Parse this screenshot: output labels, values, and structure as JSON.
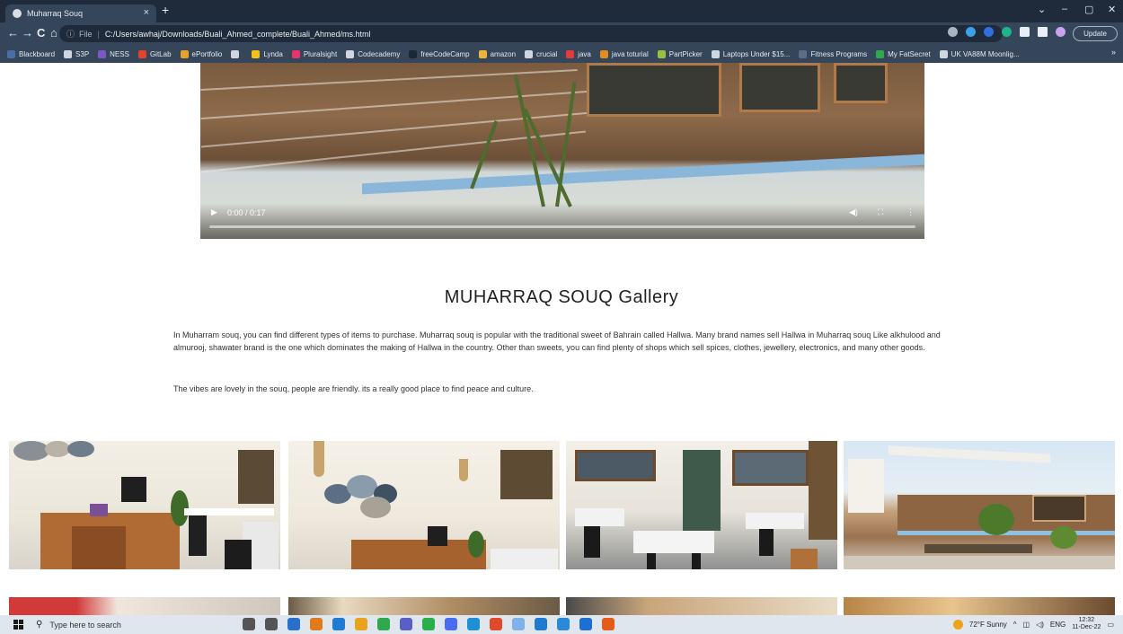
{
  "browser": {
    "tab_title": "Muharraq Souq",
    "tab_close": "×",
    "new_tab": "+",
    "window_controls": [
      "⌄",
      "–",
      "▢",
      "✕"
    ],
    "nav": {
      "back": "←",
      "forward": "→",
      "reload": "C",
      "home": "⌂"
    },
    "address": {
      "scheme_label": "File",
      "url": "C:/Users/awhaj/Downloads/Buali_Ahmed_complete/Buali_Ahmed/ms.html"
    },
    "update_label": "Update",
    "bookmarks": [
      {
        "label": "Blackboard",
        "color": "#4a6fa5"
      },
      {
        "label": "S3P",
        "color": "#cfd6df"
      },
      {
        "label": "NESS",
        "color": "#7e57c2"
      },
      {
        "label": "GitLab",
        "color": "#e2432a"
      },
      {
        "label": "ePortfolio",
        "color": "#e7a22b"
      },
      {
        "label": "",
        "color": "#cfd6df"
      },
      {
        "label": "Lynda",
        "color": "#f2c21b"
      },
      {
        "label": "Pluralsight",
        "color": "#e9346a"
      },
      {
        "label": "Codecademy",
        "color": "#cfd6df"
      },
      {
        "label": "freeCodeCamp",
        "color": "#1b2838"
      },
      {
        "label": "amazon",
        "color": "#f0b23b"
      },
      {
        "label": "crucial",
        "color": "#cfd6df"
      },
      {
        "label": "java",
        "color": "#e23b3b"
      },
      {
        "label": "java toturial",
        "color": "#e58b1f"
      },
      {
        "label": "PartPicker",
        "color": "#9bbf3a"
      },
      {
        "label": "Laptops Under $15...",
        "color": "#cfd6df"
      },
      {
        "label": "Fitness Programs",
        "color": "#5a6f86"
      },
      {
        "label": "My FatSecret",
        "color": "#2fa84f"
      },
      {
        "label": "UK VA88M Moonlig...",
        "color": "#cfd6df"
      }
    ],
    "bookmarks_more": "»"
  },
  "video": {
    "time": "0:00 / 0:17",
    "play_icon": "▶",
    "volume_icon": "◀)",
    "fullscreen_icon": "⛶",
    "menu_icon": "⋮",
    "progress": 0.0
  },
  "gallery": {
    "title": "MUHARRAQ SOUQ Gallery",
    "paragraph_1": "In Muharram souq, you can find different types of items to purchase. Muharraq souq is popular with the traditional sweet of Bahrain called Hallwa. Many brand names sell Hallwa in Muharraq souq Like alkhulood and almurooj, shawater brand is the one which dominates the making of Hallwa in the country. Other than sweets, you can find plenty of shops which sell spices, clothes, jewellery, electronics, and many other goods.",
    "paragraph_2": "The vibes are lovely in the souq, people are friendly. its a really good place to find peace and culture."
  },
  "taskbar": {
    "search_placeholder": "Type here to search",
    "weather": "72°F  Sunny",
    "language": "ENG",
    "time": "12:32",
    "date": "11-Dec-22",
    "app_colors": [
      "#555",
      "#555",
      "#2a6fc9",
      "#e07a1a",
      "#1f7ad1",
      "#e8a21b",
      "#2fa84f",
      "#5a5fc7",
      "#2ab04a",
      "#4a6cf0",
      "#1e8fd5",
      "#e04a2a",
      "#7fb2e8",
      "#1f7ad1",
      "#2b8ad8",
      "#1e6fd1",
      "#e45b1a"
    ]
  }
}
